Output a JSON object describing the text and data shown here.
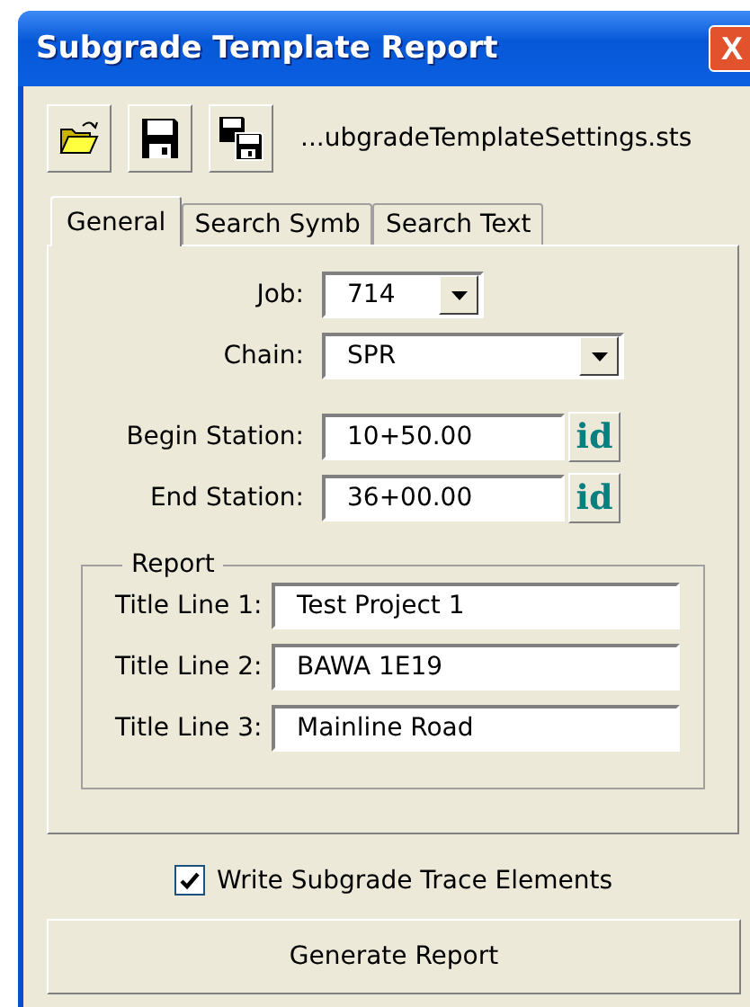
{
  "window": {
    "title": "Subgrade Template Report",
    "close_button": "X"
  },
  "toolbar": {
    "buttons": [
      {
        "kind": "open"
      },
      {
        "kind": "save"
      },
      {
        "kind": "save_all"
      }
    ],
    "file_name": "...ubgradeTemplateSettings.sts"
  },
  "tabs": [
    {
      "label": "General",
      "selected": true
    },
    {
      "label": "Search Symb",
      "selected": false
    },
    {
      "label": "Search Text",
      "selected": false
    }
  ],
  "fields": [
    {
      "kind": "combo",
      "label": "Job:",
      "value": "714"
    },
    {
      "kind": "combo",
      "label": "Chain:",
      "value": "SPR"
    },
    {
      "kind": "station",
      "label": "Begin Station:",
      "value": "10+50.00",
      "button": "id"
    },
    {
      "kind": "station",
      "label": "End Station:",
      "value": "36+00.00",
      "button": "id"
    }
  ],
  "report": {
    "legend": "Report",
    "lines": [
      {
        "label": "Title Line 1:",
        "value": "Test Project 1"
      },
      {
        "label": "Title Line 2:",
        "value": "BAWA 1E19"
      },
      {
        "label": "Title Line 3:",
        "value": "Mainline Road"
      }
    ]
  },
  "options": [
    {
      "label": "Write Subgrade Trace Elements",
      "checked": true
    }
  ],
  "generate_button": "Generate Report"
}
